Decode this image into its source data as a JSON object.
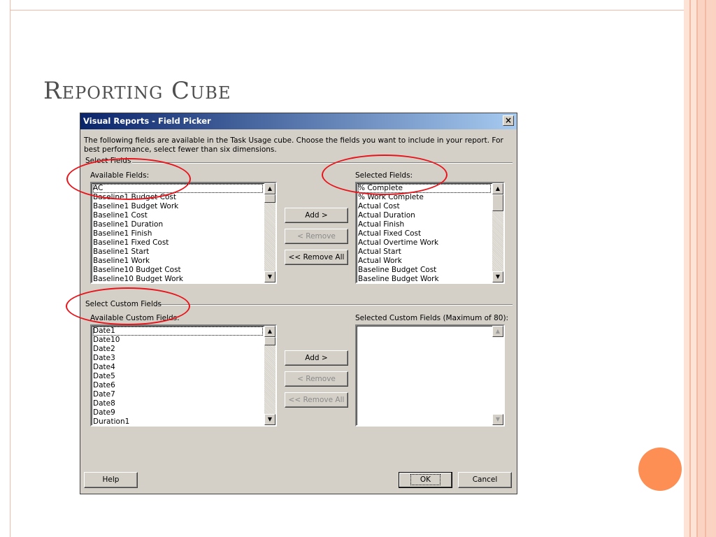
{
  "slide": {
    "title": "Reporting Cube"
  },
  "dialog": {
    "title": "Visual Reports - Field Picker",
    "close_label": "×",
    "intro": "The following fields are available in the Task Usage cube. Choose the fields you want to include in your report. For best performance, select fewer than six dimensions.",
    "select_fields_label": "Select Fields",
    "available_fields_label": "Available Fields:",
    "available_fields": [
      "AC",
      "Baseline1 Budget Cost",
      "Baseline1 Budget Work",
      "Baseline1 Cost",
      "Baseline1 Duration",
      "Baseline1 Finish",
      "Baseline1 Fixed Cost",
      "Baseline1 Start",
      "Baseline1 Work",
      "Baseline10 Budget Cost",
      "Baseline10 Budget Work"
    ],
    "selected_fields_label": "Selected Fields:",
    "selected_fields": [
      "% Complete",
      "% Work Complete",
      "Actual Cost",
      "Actual Duration",
      "Actual Finish",
      "Actual Fixed Cost",
      "Actual Overtime Work",
      "Actual Start",
      "Actual Work",
      "Baseline Budget Cost",
      "Baseline Budget Work"
    ],
    "add_label": "Add >",
    "remove_label": "< Remove",
    "remove_all_label": "<< Remove All",
    "select_custom_fields_label": "Select Custom Fields",
    "available_custom_fields_label": "Available Custom Fields:",
    "available_custom_fields": [
      "Date1",
      "Date10",
      "Date2",
      "Date3",
      "Date4",
      "Date5",
      "Date6",
      "Date7",
      "Date8",
      "Date9",
      "Duration1"
    ],
    "selected_custom_fields_label": "Selected Custom Fields (Maximum of 80):",
    "custom_add_label": "Add >",
    "custom_remove_label": "< Remove",
    "custom_remove_all_label": "<< Remove All",
    "help_label": "Help",
    "ok_label": "OK",
    "cancel_label": "Cancel"
  },
  "icons": {
    "scroll_up": "▲",
    "scroll_down": "▼"
  },
  "colors": {
    "annotation": "#e8141b",
    "accent_dot": "#fd8f55",
    "titlebar": "#0a246a"
  }
}
